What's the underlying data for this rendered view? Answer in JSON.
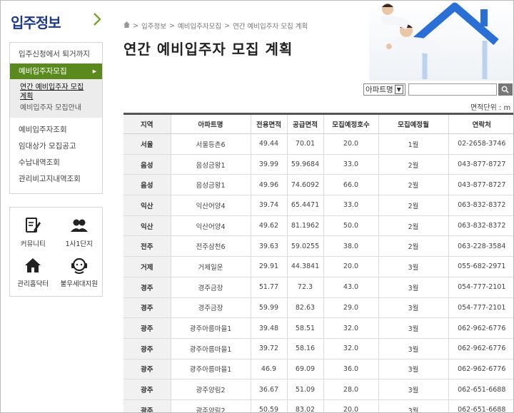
{
  "sidebar": {
    "title": "입주정보",
    "menu_top": "입주신청에서 퇴거까지",
    "menu_active": "예비입주자모집",
    "submenu": [
      "연간 예비입주자 모집 계획",
      "예비입주자 모집안내"
    ],
    "menu_items": [
      "예비입주자조회",
      "임대상가 모집공고",
      "수납내역조회",
      "관리비고지내역조회"
    ],
    "quick_links": [
      {
        "label": "커뮤니티",
        "icon": "community-icon"
      },
      {
        "label": "1사1단지",
        "icon": "people-icon"
      },
      {
        "label": "관리홈닥터",
        "icon": "house-icon"
      },
      {
        "label": "불우세대지원",
        "icon": "support-headset-icon"
      }
    ]
  },
  "breadcrumb": [
    "입주정보",
    "예비입주자모집",
    "연간 예비입주자 모집 계획"
  ],
  "page_title": "연간 예비입주자 모집 계획",
  "filter": {
    "select_value": "아파트명",
    "search_value": ""
  },
  "unit_label": "면적단위 : m",
  "table": {
    "headers": [
      "지역",
      "아파트명",
      "전용면적",
      "공급면적",
      "모집예정호수",
      "모집예정월",
      "연락처"
    ],
    "rows": [
      [
        "서울",
        "서울등촌6",
        "49.44",
        "70.01",
        "20.0",
        "1월",
        "02-2658-3746"
      ],
      [
        "음성",
        "음성금왕1",
        "39.99",
        "59.9684",
        "33.0",
        "2월",
        "043-877-8727"
      ],
      [
        "음성",
        "음성금왕1",
        "49.96",
        "74.6092",
        "66.0",
        "2월",
        "043-877-8727"
      ],
      [
        "익산",
        "익산어양4",
        "39.74",
        "65.4471",
        "33.0",
        "2월",
        "063-832-8372"
      ],
      [
        "익산",
        "익산어양4",
        "49.62",
        "81.1962",
        "50.0",
        "2월",
        "063-832-8372"
      ],
      [
        "전주",
        "전주삼천6",
        "39.63",
        "59.0255",
        "38.0",
        "2월",
        "063-228-3584"
      ],
      [
        "거제",
        "거제일운",
        "29.91",
        "44.3841",
        "20.0",
        "3월",
        "055-682-2971"
      ],
      [
        "경주",
        "경주금장",
        "51.77",
        "72.3",
        "43.0",
        "3월",
        "054-777-2101"
      ],
      [
        "경주",
        "경주금장",
        "59.99",
        "82.63",
        "29.0",
        "3월",
        "054-777-2101"
      ],
      [
        "광주",
        "광주아름마을1",
        "39.48",
        "58.51",
        "32.0",
        "3월",
        "062-962-6776"
      ],
      [
        "광주",
        "광주아름마을1",
        "39.72",
        "58.16",
        "32.0",
        "3월",
        "062-962-6776"
      ],
      [
        "광주",
        "광주아름마을1",
        "46.9",
        "69.09",
        "36.0",
        "3월",
        "062-962-6776"
      ],
      [
        "광주",
        "광주양림2",
        "36.67",
        "51.09",
        "28.0",
        "3월",
        "062-651-6688"
      ],
      [
        "광주",
        "광주양림2",
        "50.59",
        "83.02",
        "20.0",
        "3월",
        "062-651-6688"
      ]
    ]
  },
  "colors": {
    "brand_blue": "#1d3a8a",
    "active_green": "#5a8a1e",
    "chevron_green": "#7aa32a"
  }
}
